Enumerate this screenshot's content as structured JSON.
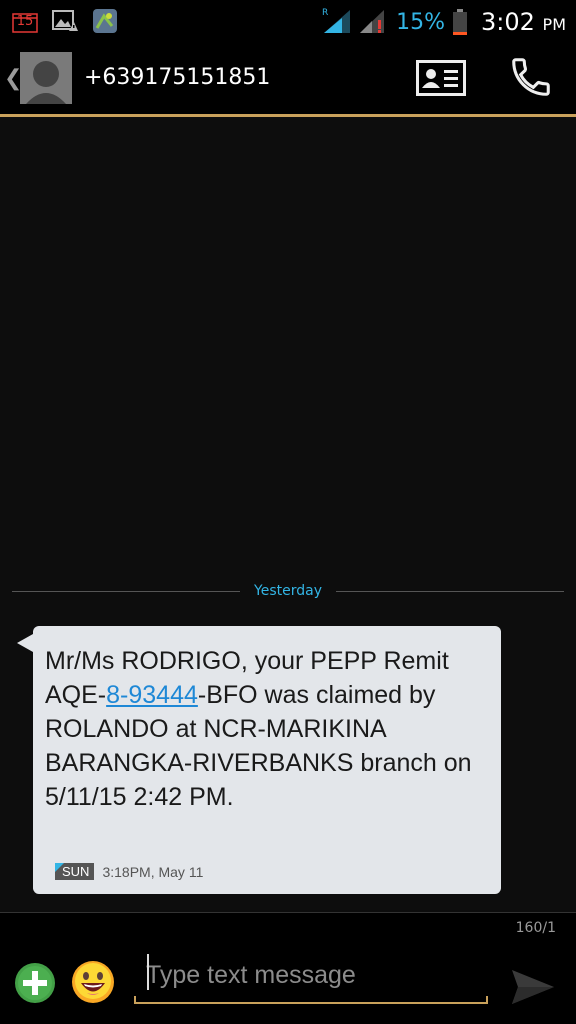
{
  "status_bar": {
    "calendar_day": "15",
    "battery_percent": "15%",
    "time": "3:02",
    "ampm": "PM",
    "battery_level": 0.15,
    "icons": [
      "calendar-icon",
      "image-warning-icon",
      "app-icon",
      "signal-roaming-icon",
      "signal-icon",
      "battery-icon"
    ]
  },
  "header": {
    "contact_number": "+639175151851",
    "actions": [
      "contact-card-icon",
      "phone-icon"
    ]
  },
  "conversation": {
    "date_divider": "Yesterday",
    "messages": [
      {
        "text_before": "Mr/Ms RODRIGO, your PEPP Remit AQE-",
        "link": "8-93444",
        "text_after": "-BFO was claimed by ROLANDO at NCR-MARIKINA BARANGKA-RIVERBANKS branch on 5/11/15 2:42 PM.",
        "sim": "SUN",
        "timestamp": "3:18PM, May 11"
      }
    ]
  },
  "compose": {
    "char_counter": "160/1",
    "placeholder": "Type text message",
    "value": ""
  },
  "colors": {
    "accent_blue": "#33b5e5",
    "divider_gold": "#c9a15b",
    "bubble_bg": "#e3e6ea",
    "low_battery": "#ff5722"
  }
}
